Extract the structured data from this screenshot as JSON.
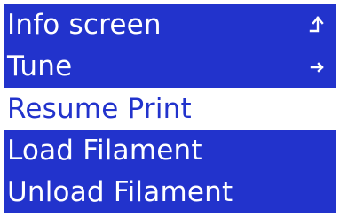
{
  "menu": {
    "items": [
      {
        "label": "Info screen",
        "icon": "return-up-icon",
        "selected": false
      },
      {
        "label": "Tune",
        "icon": "arrow-right-icon",
        "selected": false
      },
      {
        "label": "Resume Print",
        "icon": "",
        "selected": true
      },
      {
        "label": "Load Filament",
        "icon": "",
        "selected": false
      },
      {
        "label": "Unload Filament",
        "icon": "",
        "selected": false
      }
    ]
  },
  "colors": {
    "background": "#2233cc",
    "foreground": "#ffffff",
    "highlight_background": "#ffffff",
    "highlight_foreground": "#2233cc"
  }
}
